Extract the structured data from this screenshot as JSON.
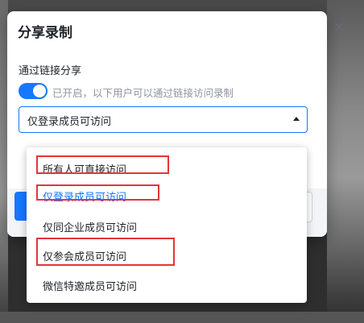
{
  "dialog": {
    "title": "分享录制",
    "close_icon": "close-icon",
    "link_share_label": "通过链接分享",
    "toggle": {
      "on": true,
      "description": "已开启，以下用户可以通过链接访问录制"
    },
    "select": {
      "value": "仅登录成员可访问",
      "arrow_icon": "caret-up-icon"
    },
    "options": [
      {
        "label": "所有人可直接访问"
      },
      {
        "label": "仅登录成员可访问",
        "selected": true
      },
      {
        "label": "仅同企业成员可访问"
      },
      {
        "label": "仅参会成员可访问"
      },
      {
        "label": "微信特邀成员可访问"
      }
    ]
  },
  "colors": {
    "accent": "#1677ff",
    "annotation": "#e5343b"
  }
}
